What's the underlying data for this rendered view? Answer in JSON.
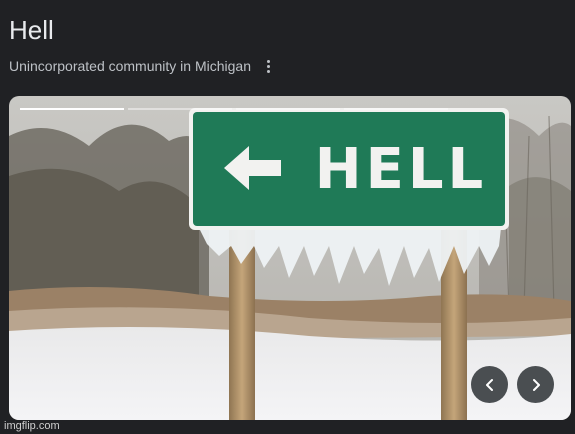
{
  "header": {
    "title": "Hell",
    "subtitle": "Unincorporated community in Michigan"
  },
  "image": {
    "sign_text": "HELL",
    "sign_color": "#1f7a57",
    "progress_segments": 5,
    "active_segment": 0
  },
  "controls": {
    "more_icon": "more-vert-icon",
    "prev_icon": "chevron-left-icon",
    "next_icon": "chevron-right-icon"
  },
  "watermark": "imgflip.com"
}
